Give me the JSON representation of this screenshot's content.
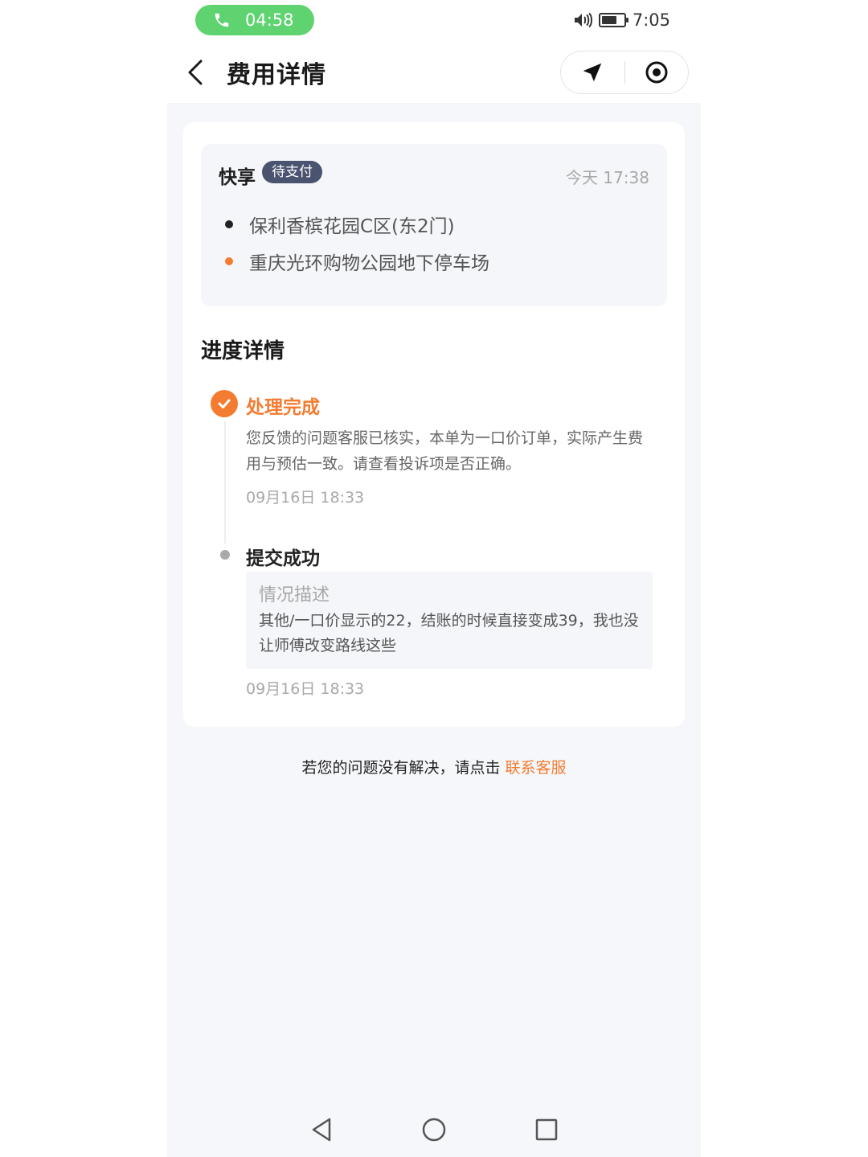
{
  "status_bar": {
    "call_time": "04:58",
    "clock": "7:05"
  },
  "header": {
    "title": "费用详情",
    "icons": [
      "back-icon",
      "location-arrow-icon",
      "record-icon"
    ]
  },
  "order": {
    "brand": "快享",
    "status_badge": "待支付",
    "time": "今天 17:38",
    "start_address": "保利香槟花园C区(东2门)",
    "end_address": "重庆光环购物公园地下停车场",
    "start_dot_color": "#222222",
    "end_dot_color": "#f47c31"
  },
  "progress": {
    "section_title": "进度详情",
    "steps": [
      {
        "title": "处理完成",
        "description": "您反馈的问题客服已核实，本单为一口价订单，实际产生费用与预估一致。请查看投诉项是否正确。",
        "time": "09月16日 18:33"
      },
      {
        "title": "提交成功",
        "desc_label": "情况描述",
        "desc_text": "其他/一口价显示的22，结账的时候直接变成39，我也没让师傅改变路线这些",
        "time": "09月16日 18:33"
      }
    ]
  },
  "footer": {
    "help_text": "若您的问题没有解决，请点击",
    "contact_link": "联系客服"
  },
  "nav": {
    "icons": [
      "nav-back-icon",
      "nav-home-icon",
      "nav-recents-icon"
    ]
  },
  "colors": {
    "accent": "#f47c31",
    "call_green": "#5ed36f",
    "badge_bg": "#4a5370"
  }
}
